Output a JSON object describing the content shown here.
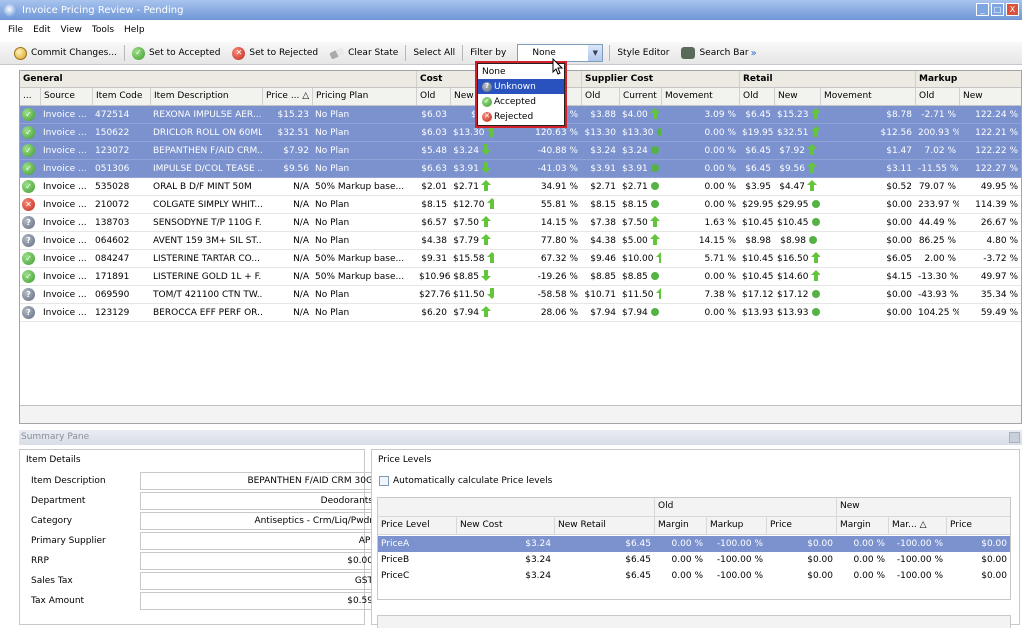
{
  "window": {
    "title": "Invoice Pricing Review - Pending",
    "buttons": [
      "_",
      "□",
      "X"
    ]
  },
  "menu": [
    "File",
    "Edit",
    "View",
    "Tools",
    "Help"
  ],
  "toolbar": {
    "commit": "Commit Changes...",
    "accept": "Set to Accepted",
    "reject": "Set to Rejected",
    "clear": "Clear State",
    "select_all": "Select All",
    "filter_by": "Filter by",
    "filter_value": "None",
    "style_editor": "Style Editor",
    "search_bar": "Search Bar",
    "more": "»"
  },
  "filter_options": [
    {
      "label": "None",
      "icon": ""
    },
    {
      "label": "Unknown",
      "icon": "question"
    },
    {
      "label": "Accepted",
      "icon": "check"
    },
    {
      "label": "Rejected",
      "icon": "x"
    }
  ],
  "grid": {
    "groups": [
      "General",
      "Cost",
      "Supplier Cost",
      "Retail",
      "Markup"
    ],
    "columns": [
      "...",
      "Source",
      "Item Code",
      "Item Description",
      "Price ... △",
      "Pricing Plan",
      "Old",
      "New",
      "",
      "Old",
      "Current",
      "Movement",
      "Old",
      "New",
      "Movement",
      "Old",
      "New"
    ],
    "rows": [
      {
        "status": "accepted",
        "sel": true,
        "source": "Invoice ...",
        "code": "472514",
        "desc": "REXONA IMPULSE AER...",
        "price": "$15.23",
        "plan": "No Plan",
        "cost_old": "$6.03",
        "cost_new": "$6.2",
        "cost_mov": "%",
        "cost_arrow": "",
        "sup_old": "$3.88",
        "sup_cur": "$4.00",
        "sup_arrow": "up",
        "sup_mov": "3.09 %",
        "ret_old": "$6.45",
        "ret_new": "$15.23",
        "ret_arrow": "up",
        "ret_mov": "$8.78",
        "mk_old": "-2.71 %",
        "mk_new": "122.24 %"
      },
      {
        "status": "accepted",
        "sel": true,
        "source": "Invoice ...",
        "code": "150622",
        "desc": "DRICLOR ROLL ON 60ML",
        "price": "$32.51",
        "plan": "No Plan",
        "cost_old": "$6.03",
        "cost_new": "$13.30",
        "cost_mov": "120.63 %",
        "cost_arrow": "up",
        "sup_old": "$13.30",
        "sup_cur": "$13.30",
        "sup_arrow": "eq",
        "sup_mov": "0.00 %",
        "ret_old": "$19.95",
        "ret_new": "$32.51",
        "ret_arrow": "up",
        "ret_mov": "$12.56",
        "mk_old": "200.93 %",
        "mk_new": "122.21 %"
      },
      {
        "status": "accepted",
        "sel": true,
        "source": "Invoice ...",
        "code": "123072",
        "desc": "BEPANTHEN F/AID CRM...",
        "price": "$7.92",
        "plan": "No Plan",
        "cost_old": "$5.48",
        "cost_new": "$3.24",
        "cost_mov": "-40.88 %",
        "cost_arrow": "down",
        "sup_old": "$3.24",
        "sup_cur": "$3.24",
        "sup_arrow": "eq",
        "sup_mov": "0.00 %",
        "ret_old": "$6.45",
        "ret_new": "$7.92",
        "ret_arrow": "up",
        "ret_mov": "$1.47",
        "mk_old": "7.02 %",
        "mk_new": "122.22 %"
      },
      {
        "status": "accepted",
        "sel": true,
        "source": "Invoice ...",
        "code": "051306",
        "desc": "IMPULSE D/COL TEASE ...",
        "price": "$9.56",
        "plan": "No Plan",
        "cost_old": "$6.63",
        "cost_new": "$3.91",
        "cost_mov": "-41.03 %",
        "cost_arrow": "down",
        "sup_old": "$3.91",
        "sup_cur": "$3.91",
        "sup_arrow": "eq",
        "sup_mov": "0.00 %",
        "ret_old": "$6.45",
        "ret_new": "$9.56",
        "ret_arrow": "up",
        "ret_mov": "$3.11",
        "mk_old": "-11.55 %",
        "mk_new": "122.27 %"
      },
      {
        "status": "accepted",
        "sel": false,
        "source": "Invoice ...",
        "code": "535028",
        "desc": "ORAL B D/F MINT 50M",
        "price": "N/A",
        "plan": "50% Markup base...",
        "cost_old": "$2.01",
        "cost_new": "$2.71",
        "cost_mov": "34.91 %",
        "cost_arrow": "up",
        "sup_old": "$2.71",
        "sup_cur": "$2.71",
        "sup_arrow": "eq",
        "sup_mov": "0.00 %",
        "ret_old": "$3.95",
        "ret_new": "$4.47",
        "ret_arrow": "up",
        "ret_mov": "$0.52",
        "mk_old": "79.07 %",
        "mk_new": "49.95 %"
      },
      {
        "status": "rejected",
        "sel": false,
        "source": "Invoice ...",
        "code": "210072",
        "desc": "COLGATE SIMPLY WHIT...",
        "price": "N/A",
        "plan": "No Plan",
        "cost_old": "$8.15",
        "cost_new": "$12.70",
        "cost_mov": "55.81 %",
        "cost_arrow": "up",
        "sup_old": "$8.15",
        "sup_cur": "$8.15",
        "sup_arrow": "eq",
        "sup_mov": "0.00 %",
        "ret_old": "$29.95",
        "ret_new": "$29.95",
        "ret_arrow": "eq",
        "ret_mov": "$0.00",
        "mk_old": "233.97 %",
        "mk_new": "114.39 %"
      },
      {
        "status": "unknown",
        "sel": false,
        "source": "Invoice ...",
        "code": "138703",
        "desc": "SENSODYNE T/P 110G F...",
        "price": "N/A",
        "plan": "No Plan",
        "cost_old": "$6.57",
        "cost_new": "$7.50",
        "cost_mov": "14.15 %",
        "cost_arrow": "up",
        "sup_old": "$7.38",
        "sup_cur": "$7.50",
        "sup_arrow": "up",
        "sup_mov": "1.63 %",
        "ret_old": "$10.45",
        "ret_new": "$10.45",
        "ret_arrow": "eq",
        "ret_mov": "$0.00",
        "mk_old": "44.49 %",
        "mk_new": "26.67 %"
      },
      {
        "status": "unknown",
        "sel": false,
        "source": "Invoice ...",
        "code": "064602",
        "desc": "AVENT 159 3M+ SIL ST...",
        "price": "N/A",
        "plan": "No Plan",
        "cost_old": "$4.38",
        "cost_new": "$7.79",
        "cost_mov": "77.80 %",
        "cost_arrow": "up",
        "sup_old": "$4.38",
        "sup_cur": "$5.00",
        "sup_arrow": "up",
        "sup_mov": "14.15 %",
        "ret_old": "$8.98",
        "ret_new": "$8.98",
        "ret_arrow": "eq",
        "ret_mov": "$0.00",
        "mk_old": "86.25 %",
        "mk_new": "4.80 %"
      },
      {
        "status": "accepted",
        "sel": false,
        "source": "Invoice ...",
        "code": "084247",
        "desc": "LISTERINE TARTAR CO...",
        "price": "N/A",
        "plan": "50% Markup base...",
        "cost_old": "$9.31",
        "cost_new": "$15.58",
        "cost_mov": "67.32 %",
        "cost_arrow": "up",
        "sup_old": "$9.46",
        "sup_cur": "$10.00",
        "sup_arrow": "up",
        "sup_mov": "5.71 %",
        "ret_old": "$10.45",
        "ret_new": "$16.50",
        "ret_arrow": "up",
        "ret_mov": "$6.05",
        "mk_old": "2.00 %",
        "mk_new": "-3.72 %"
      },
      {
        "status": "accepted",
        "sel": false,
        "source": "Invoice ...",
        "code": "171891",
        "desc": "LISTERINE GOLD 1L + F...",
        "price": "N/A",
        "plan": "50% Markup base...",
        "cost_old": "$10.96",
        "cost_new": "$8.85",
        "cost_mov": "-19.26 %",
        "cost_arrow": "down",
        "sup_old": "$8.85",
        "sup_cur": "$8.85",
        "sup_arrow": "eq",
        "sup_mov": "0.00 %",
        "ret_old": "$10.45",
        "ret_new": "$14.60",
        "ret_arrow": "up",
        "ret_mov": "$4.15",
        "mk_old": "-13.30 %",
        "mk_new": "49.97 %"
      },
      {
        "status": "unknown",
        "sel": false,
        "source": "Invoice ...",
        "code": "069590",
        "desc": "TOM/T 421100 CTN TW...",
        "price": "N/A",
        "plan": "No Plan",
        "cost_old": "$27.76",
        "cost_new": "$11.50",
        "cost_mov": "-58.58 %",
        "cost_arrow": "down",
        "sup_old": "$10.71",
        "sup_cur": "$11.50",
        "sup_arrow": "up",
        "sup_mov": "7.38 %",
        "ret_old": "$17.12",
        "ret_new": "$17.12",
        "ret_arrow": "eq",
        "ret_mov": "$0.00",
        "mk_old": "-43.93 %",
        "mk_new": "35.34 %"
      },
      {
        "status": "unknown",
        "sel": false,
        "source": "Invoice ...",
        "code": "123129",
        "desc": "BEROCCA EFF PERF OR...",
        "price": "N/A",
        "plan": "No Plan",
        "cost_old": "$6.20",
        "cost_new": "$7.94",
        "cost_mov": "28.06 %",
        "cost_arrow": "up",
        "sup_old": "$7.94",
        "sup_cur": "$7.94",
        "sup_arrow": "eq",
        "sup_mov": "0.00 %",
        "ret_old": "$13.93",
        "ret_new": "$13.93",
        "ret_arrow": "eq",
        "ret_mov": "$0.00",
        "mk_old": "104.25 %",
        "mk_new": "59.49 %"
      }
    ]
  },
  "summary": {
    "title": "Summary Pane",
    "item_details": {
      "title": "Item Details",
      "fields": [
        {
          "label": "Item Description",
          "value": "BEPANTHEN F/AID CRM 30G"
        },
        {
          "label": "Department",
          "value": "Deodorants"
        },
        {
          "label": "Category",
          "value": "Antiseptics - Crm/Liq/Pwdr"
        },
        {
          "label": "Primary Supplier",
          "value": "API"
        },
        {
          "label": "RRP",
          "value": "$0.00"
        },
        {
          "label": "Sales Tax",
          "value": "GST"
        },
        {
          "label": "Tax Amount",
          "value": "$0.59"
        }
      ]
    },
    "price_levels": {
      "title": "Price Levels",
      "auto_calc": "Automatically calculate Price levels",
      "band_old": "Old",
      "band_new": "New",
      "columns": [
        "Price Level",
        "New Cost",
        "New Retail",
        "Margin",
        "Markup",
        "Price",
        "Margin",
        "Mar... △",
        "Price"
      ],
      "rows": [
        {
          "sel": true,
          "level": "PriceA",
          "cost": "$3.24",
          "retail": "$6.45",
          "old_margin": "0.00 %",
          "old_markup": "-100.00 %",
          "old_price": "$0.00",
          "new_margin": "0.00 %",
          "new_markup": "-100.00 %",
          "new_price": "$0.00"
        },
        {
          "sel": false,
          "level": "PriceB",
          "cost": "$3.24",
          "retail": "$6.45",
          "old_margin": "0.00 %",
          "old_markup": "-100.00 %",
          "old_price": "$0.00",
          "new_margin": "0.00 %",
          "new_markup": "-100.00 %",
          "new_price": "$0.00"
        },
        {
          "sel": false,
          "level": "PriceC",
          "cost": "$3.24",
          "retail": "$6.45",
          "old_margin": "0.00 %",
          "old_markup": "-100.00 %",
          "old_price": "$0.00",
          "new_margin": "0.00 %",
          "new_markup": "-100.00 %",
          "new_price": "$0.00"
        }
      ]
    }
  }
}
